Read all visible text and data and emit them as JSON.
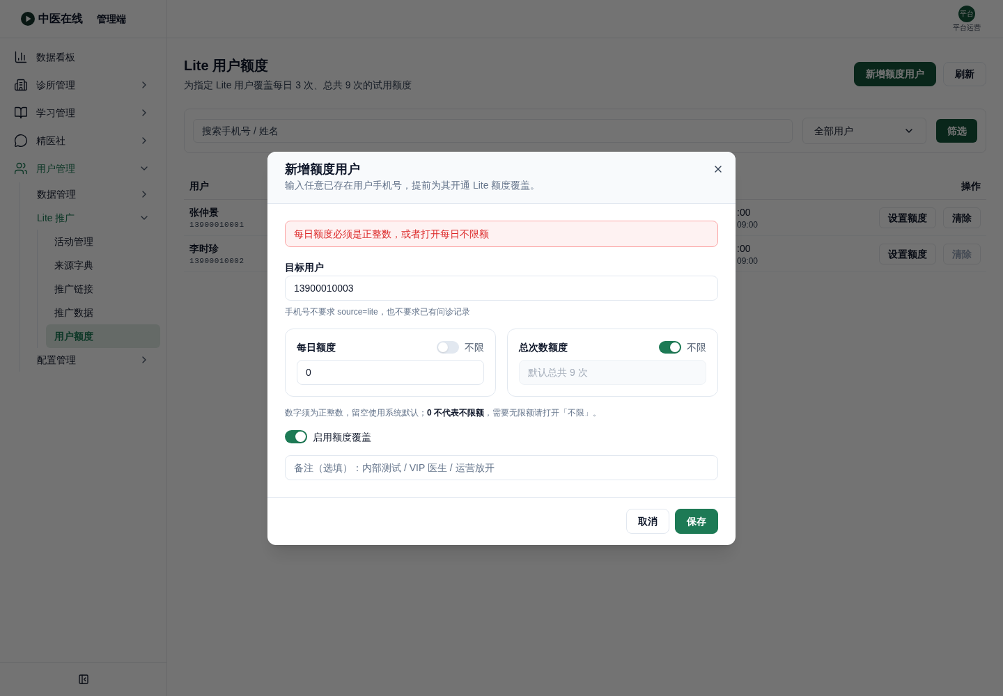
{
  "sidebar": {
    "brand": {
      "name": "中医在线",
      "suffix": "管理端"
    },
    "items": [
      {
        "label": "数据看板",
        "kind": "link",
        "selected": false
      },
      {
        "label": "诊所管理",
        "kind": "group",
        "expanded": false
      },
      {
        "label": "学习管理",
        "kind": "group",
        "expanded": false
      },
      {
        "label": "精医社",
        "kind": "group",
        "expanded": false
      },
      {
        "label": "用户管理",
        "kind": "group",
        "expanded": true,
        "children": [
          {
            "label": "数据管理",
            "kind": "group",
            "expanded": false
          },
          {
            "label": "Lite 推广",
            "kind": "group",
            "expanded": true,
            "children": [
              {
                "label": "活动管理",
                "kind": "link",
                "selected": false
              },
              {
                "label": "来源字典",
                "kind": "link",
                "selected": false
              },
              {
                "label": "推广链接",
                "kind": "link",
                "selected": false
              },
              {
                "label": "推广数据",
                "kind": "link",
                "selected": false
              },
              {
                "label": "用户额度",
                "kind": "link",
                "selected": true
              }
            ]
          },
          {
            "label": "配置管理",
            "kind": "group",
            "expanded": false
          }
        ]
      }
    ]
  },
  "header": {
    "avatar": "平台",
    "user_name": "平台运营"
  },
  "page": {
    "title": "Lite 用户额度",
    "subtitle": "为指定 Lite 用户覆盖每日 3 次、总共 9 次的试用额度",
    "actions": [
      {
        "label": "新增额度用户",
        "kind": "primary"
      },
      {
        "label": "刷新",
        "kind": "secondary"
      }
    ]
  },
  "filters": {
    "search": {
      "placeholder": "搜索手机号 / 姓名"
    },
    "select": {
      "value": "全部用户"
    },
    "button": "筛选"
  },
  "table": {
    "columns": [
      "用户",
      "操作"
    ],
    "rows": [
      {
        "user": {
          "name": "张仲景",
          "phone": "13900010001"
        },
        "column_partial": {
          "top": ":00",
          "bottom": "09:00"
        },
        "actions": [
          {
            "label": "设置额度",
            "disabled": false
          },
          {
            "label": "清除",
            "disabled": false
          }
        ]
      },
      {
        "user": {
          "name": "李时珍",
          "phone": "13900010002"
        },
        "column_partial": {
          "top": ":00",
          "bottom": "09:00"
        },
        "actions": [
          {
            "label": "设置额度",
            "disabled": false
          },
          {
            "label": "清除",
            "disabled": true
          }
        ]
      }
    ]
  },
  "dialog": {
    "title": "新增额度用户",
    "subtitle": "输入任意已存在用户手机号，提前为其开通 Lite 额度覆盖。",
    "error": "每日额度必须是正整数，或者打开每日不限额",
    "target_user": {
      "label": "目标用户",
      "value": "13900010003",
      "help": "手机号不要求 source=lite，也不要求已有问诊记录"
    },
    "quotas": [
      {
        "label": "每日额度",
        "toggle_label": "不限",
        "unlimited": false,
        "value": "0"
      },
      {
        "label": "总次数额度",
        "toggle_label": "不限",
        "unlimited": true,
        "placeholder": "默认总共 9 次"
      }
    ],
    "quota_help": "数字须为正整数，留空使用系统默认；**0 不代表不限额**，需要无限额请打开「不限」。",
    "override": {
      "label": "启用额度覆盖",
      "on": true
    },
    "note": {
      "placeholder": "备注（选填）：内部测试 / VIP 医生 / 运营放开"
    },
    "buttons": [
      {
        "label": "取消",
        "kind": "secondary"
      },
      {
        "label": "保存",
        "kind": "primary"
      }
    ]
  }
}
